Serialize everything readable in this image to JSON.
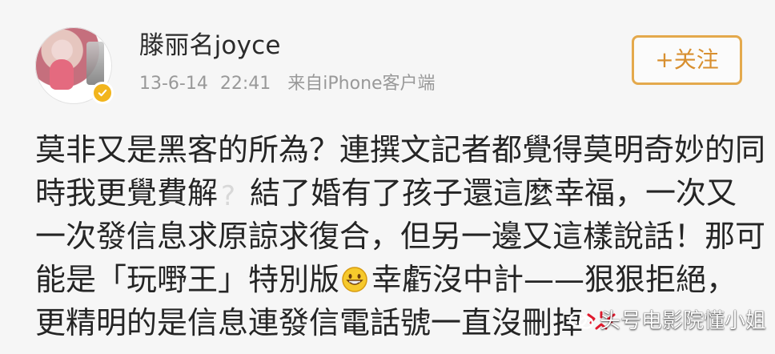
{
  "header": {
    "username": "滕丽名joyce",
    "date": "13-6-14",
    "time": "22:41",
    "source": "来自iPhone客户端",
    "follow_label": "+关注"
  },
  "post": {
    "line1": "莫非又是黑客的所為？連撰文記者都覺得莫明奇妙的同",
    "line2a": "時我更覺費解",
    "line2b": "結了婚有了孩子還這麼幸福，一次又",
    "line3": "一次發信息求原諒求復合，但另一邊又這樣說話！那可",
    "line4a": "能是「玩嘢王」特別版",
    "line4b": "幸虧沒中計——狠狠拒絕，",
    "line5": "更精明的是信息連發信電話號一直沒刪掉"
  },
  "watermark": {
    "text": "头号电影院懂小姐"
  },
  "icons": {
    "verified": "verified-badge-icon",
    "question": "question-mark-icon",
    "grin": "grinning-face-icon",
    "angry": "angry-icon",
    "watermark_logo": "wechat-icon"
  },
  "colors": {
    "follow_accent": "#d88f2f",
    "meta_gray": "#999999",
    "verified_gold": "#f2b51d"
  }
}
